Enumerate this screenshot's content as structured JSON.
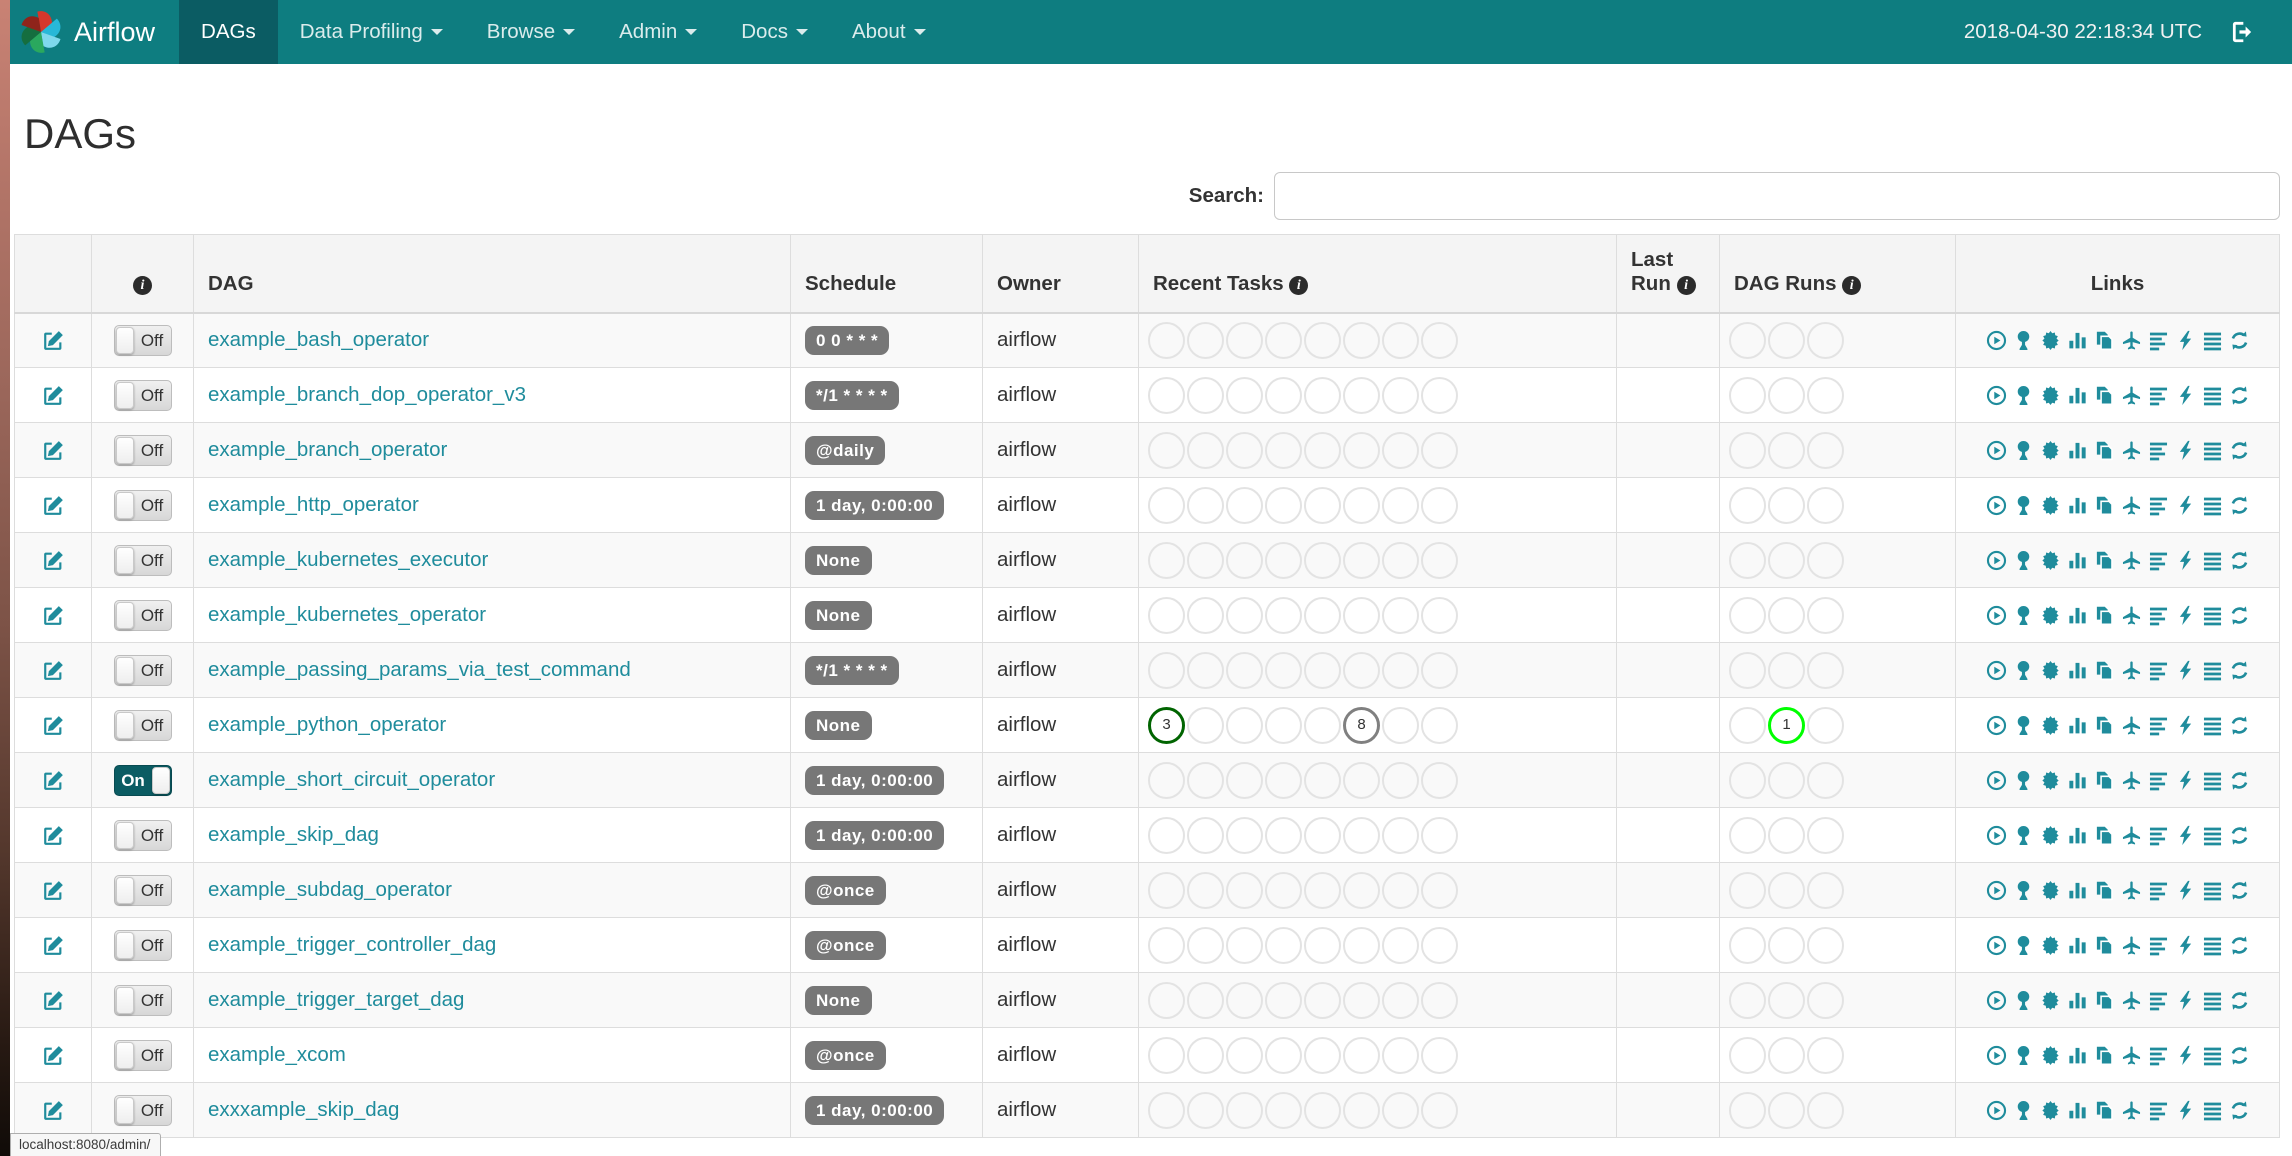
{
  "nav": {
    "brand": "Airflow",
    "items": [
      {
        "label": "DAGs",
        "active": true,
        "caret": false
      },
      {
        "label": "Data Profiling",
        "active": false,
        "caret": true
      },
      {
        "label": "Browse",
        "active": false,
        "caret": true
      },
      {
        "label": "Admin",
        "active": false,
        "caret": true
      },
      {
        "label": "Docs",
        "active": false,
        "caret": true
      },
      {
        "label": "About",
        "active": false,
        "caret": true
      }
    ],
    "clock": "2018-04-30 22:18:34 UTC",
    "logout_icon": "sign-out"
  },
  "page": {
    "title": "DAGs",
    "search_label": "Search:",
    "search_value": "",
    "status_bar": "localhost:8080/admin/"
  },
  "colors": {
    "navbar": "#0e7d80",
    "navbar_active": "#0b5c63",
    "link_teal": "#1f8c9c",
    "badge_gray": "#777777",
    "ring_success": "#006400",
    "ring_queued": "#808080",
    "ring_running": "#00ff00",
    "ring_empty": "#e3e3e3",
    "toggle_on": "#0b5c63"
  },
  "table": {
    "headers": {
      "edit": "",
      "toggle_info_icon": "info-icon",
      "dag": "DAG",
      "schedule": "Schedule",
      "owner": "Owner",
      "recent_tasks": "Recent Tasks",
      "last_run": "Last Run",
      "dag_runs": "DAG Runs",
      "links": "Links"
    },
    "recent_task_slots": 8,
    "dag_run_slots": 3,
    "link_icons": [
      "trigger-dag",
      "tree-view",
      "graph-view",
      "tasks-duration",
      "task-tries",
      "landing-times",
      "gantt-view",
      "code-view",
      "dag-details",
      "refresh"
    ],
    "rows": [
      {
        "dag": "example_bash_operator",
        "schedule": "0 0 * * *",
        "owner": "airflow",
        "state": "Off",
        "last_run": "",
        "recent_tasks": [],
        "dag_runs": []
      },
      {
        "dag": "example_branch_dop_operator_v3",
        "schedule": "*/1 * * * *",
        "owner": "airflow",
        "state": "Off",
        "last_run": "",
        "recent_tasks": [],
        "dag_runs": []
      },
      {
        "dag": "example_branch_operator",
        "schedule": "@daily",
        "owner": "airflow",
        "state": "Off",
        "last_run": "",
        "recent_tasks": [],
        "dag_runs": []
      },
      {
        "dag": "example_http_operator",
        "schedule": "1 day, 0:00:00",
        "owner": "airflow",
        "state": "Off",
        "last_run": "",
        "recent_tasks": [],
        "dag_runs": []
      },
      {
        "dag": "example_kubernetes_executor",
        "schedule": "None",
        "owner": "airflow",
        "state": "Off",
        "last_run": "",
        "recent_tasks": [],
        "dag_runs": []
      },
      {
        "dag": "example_kubernetes_operator",
        "schedule": "None",
        "owner": "airflow",
        "state": "Off",
        "last_run": "",
        "recent_tasks": [],
        "dag_runs": []
      },
      {
        "dag": "example_passing_params_via_test_command",
        "schedule": "*/1 * * * *",
        "owner": "airflow",
        "state": "Off",
        "last_run": "",
        "recent_tasks": [],
        "dag_runs": []
      },
      {
        "dag": "example_python_operator",
        "schedule": "None",
        "owner": "airflow",
        "state": "Off",
        "last_run": "",
        "recent_tasks": [
          {
            "slot": 0,
            "value": "3",
            "ring": "#006400"
          },
          {
            "slot": 5,
            "value": "8",
            "ring": "#808080"
          }
        ],
        "dag_runs": [
          {
            "slot": 1,
            "value": "1",
            "ring": "#00ff00"
          }
        ]
      },
      {
        "dag": "example_short_circuit_operator",
        "schedule": "1 day, 0:00:00",
        "owner": "airflow",
        "state": "On",
        "last_run": "",
        "recent_tasks": [],
        "dag_runs": []
      },
      {
        "dag": "example_skip_dag",
        "schedule": "1 day, 0:00:00",
        "owner": "airflow",
        "state": "Off",
        "last_run": "",
        "recent_tasks": [],
        "dag_runs": []
      },
      {
        "dag": "example_subdag_operator",
        "schedule": "@once",
        "owner": "airflow",
        "state": "Off",
        "last_run": "",
        "recent_tasks": [],
        "dag_runs": []
      },
      {
        "dag": "example_trigger_controller_dag",
        "schedule": "@once",
        "owner": "airflow",
        "state": "Off",
        "last_run": "",
        "recent_tasks": [],
        "dag_runs": []
      },
      {
        "dag": "example_trigger_target_dag",
        "schedule": "None",
        "owner": "airflow",
        "state": "Off",
        "last_run": "",
        "recent_tasks": [],
        "dag_runs": []
      },
      {
        "dag": "example_xcom",
        "schedule": "@once",
        "owner": "airflow",
        "state": "Off",
        "last_run": "",
        "recent_tasks": [],
        "dag_runs": []
      },
      {
        "dag": "exxxample_skip_dag",
        "schedule": "1 day, 0:00:00",
        "owner": "airflow",
        "state": "Off",
        "last_run": "",
        "recent_tasks": [],
        "dag_runs": []
      }
    ]
  }
}
